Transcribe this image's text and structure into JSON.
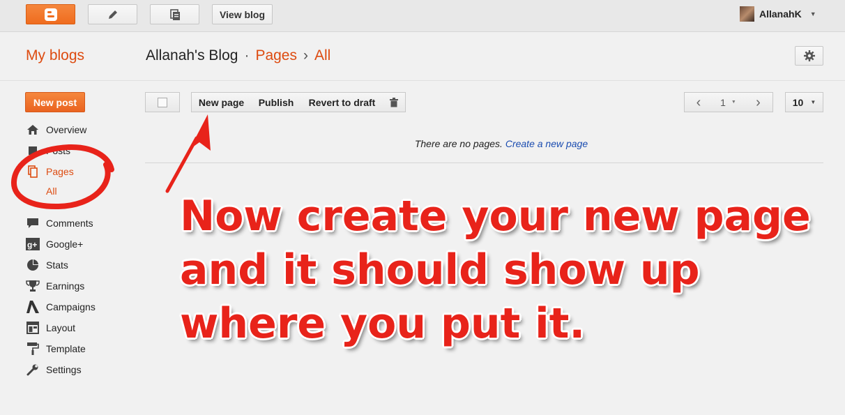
{
  "topbar": {
    "view_blog_label": "View blog",
    "username": "AllanahK"
  },
  "header": {
    "my_blogs": "My blogs",
    "blog_name": "Allanah's Blog",
    "crumb_dot": "·",
    "crumb_pages": "Pages",
    "crumb_arrow": "›",
    "crumb_all": "All"
  },
  "sidebar": {
    "new_post": "New post",
    "items": [
      {
        "label": "Overview",
        "icon": "home-icon"
      },
      {
        "label": "Posts",
        "icon": "posts-icon"
      },
      {
        "label": "Pages",
        "icon": "pages-icon"
      },
      {
        "label": "Comments",
        "icon": "comments-icon"
      },
      {
        "label": "Google+",
        "icon": "google-plus-icon"
      },
      {
        "label": "Stats",
        "icon": "stats-icon"
      },
      {
        "label": "Earnings",
        "icon": "trophy-icon"
      },
      {
        "label": "Campaigns",
        "icon": "adwords-icon"
      },
      {
        "label": "Layout",
        "icon": "layout-icon"
      },
      {
        "label": "Template",
        "icon": "paint-roller-icon"
      },
      {
        "label": "Settings",
        "icon": "wrench-icon"
      }
    ],
    "sub_all": "All"
  },
  "toolbar": {
    "new_page": "New page",
    "publish": "Publish",
    "revert": "Revert to draft",
    "page_number": "1",
    "per_page": "10"
  },
  "main": {
    "no_pages": "There are no pages.",
    "create_link": "Create a new page"
  },
  "annotation": {
    "text": "Now create your new page and it should show up where you put it."
  },
  "colors": {
    "accent": "#dd4b10",
    "annotation_red": "#e8231a",
    "link": "#1a4cb0"
  }
}
